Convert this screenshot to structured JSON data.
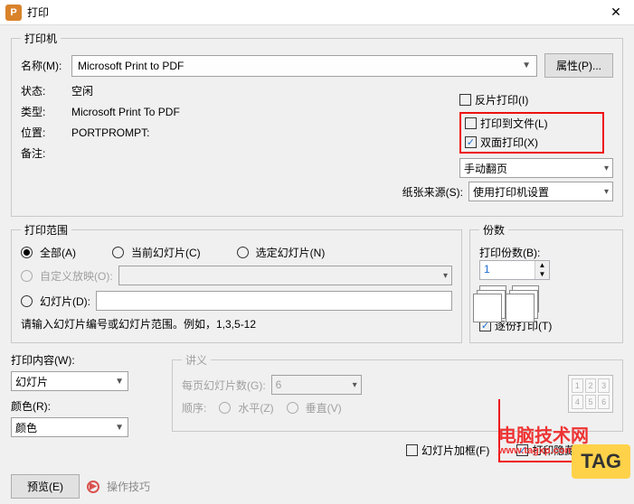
{
  "titlebar": {
    "title": "打印"
  },
  "printer": {
    "legend": "打印机",
    "name_label": "名称(M):",
    "name_value": "Microsoft Print to PDF",
    "properties_btn": "属性(P)...",
    "status_label": "状态:",
    "status_value": "空闲",
    "type_label": "类型:",
    "type_value": "Microsoft Print To PDF",
    "loc_label": "位置:",
    "loc_value": "PORTPROMPT:",
    "comment_label": "备注:",
    "reverse_label": "反片打印(I)",
    "to_file_label": "打印到文件(L)",
    "duplex_label": "双面打印(X)",
    "manual_flip": "手动翻页",
    "paper_source_label": "纸张来源(S):",
    "paper_source_value": "使用打印机设置"
  },
  "range": {
    "legend": "打印范围",
    "all": "全部(A)",
    "current": "当前幻灯片(C)",
    "selected": "选定幻灯片(N)",
    "custom_show": "自定义放映(O):",
    "slides": "幻灯片(D):",
    "hint": "请输入幻灯片编号或幻灯片范围。例如，1,3,5-12"
  },
  "copies": {
    "legend": "份数",
    "count_label": "打印份数(B):",
    "count_value": "1",
    "collate_label": "逐份打印(T)"
  },
  "content": {
    "label": "打印内容(W):",
    "value": "幻灯片",
    "color_label": "颜色(R):",
    "color_value": "颜色"
  },
  "handout": {
    "legend": "讲义",
    "per_page_label": "每页幻灯片数(G):",
    "per_page_value": "6",
    "order_label": "顺序:",
    "horizontal": "水平(Z)",
    "vertical": "垂直(V)",
    "cells": [
      "1",
      "2",
      "3",
      "4",
      "5",
      "6"
    ]
  },
  "options": {
    "frame_label": "幻灯片加框(F)",
    "hidden_label": "打印隐藏幻灯片(H)"
  },
  "footer": {
    "preview_btn": "预览(E)",
    "tips": "操作技巧"
  },
  "watermark": {
    "title": "电脑技术网",
    "url": "www.tagxp.com",
    "tag": "TAG"
  }
}
